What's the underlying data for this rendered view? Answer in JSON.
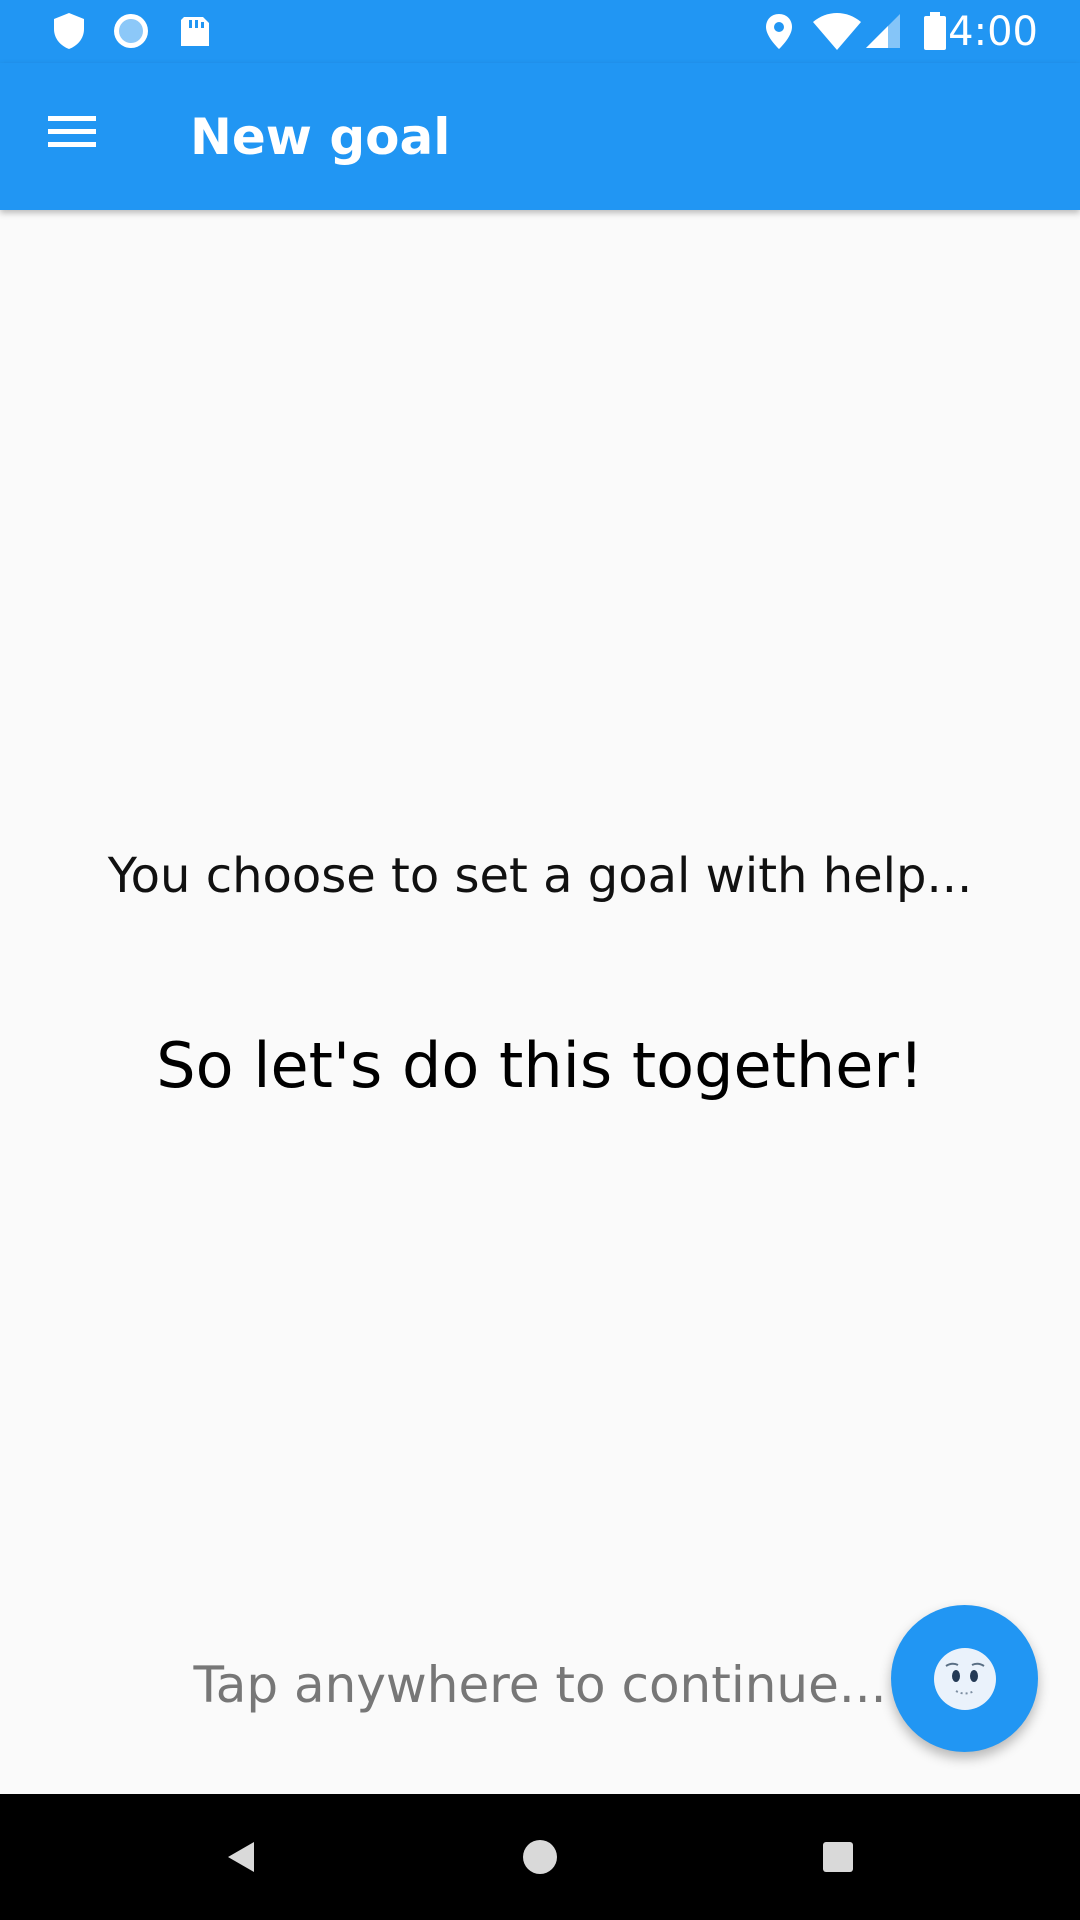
{
  "status_bar": {
    "time": "4:00",
    "left_icons": [
      "shield-icon",
      "loading-circle-icon",
      "sd-card-icon"
    ],
    "right_icons": [
      "location-icon",
      "wifi-icon",
      "cell-signal-icon",
      "battery-icon"
    ]
  },
  "app_bar": {
    "title": "New goal",
    "menu_icon": "menu-icon"
  },
  "main": {
    "intro": "You choose to set a goal with help...",
    "together": "So let's do this together!",
    "tap_hint": "Tap anywhere to continue..."
  },
  "fab": {
    "icon": "face-icon"
  },
  "nav_bar": {
    "buttons": [
      "back-button",
      "home-button",
      "recents-button"
    ]
  },
  "colors": {
    "primary": "#2196f3",
    "background": "#fafafa",
    "text": "#111111",
    "hint": "#777777",
    "nav": "#000000"
  }
}
